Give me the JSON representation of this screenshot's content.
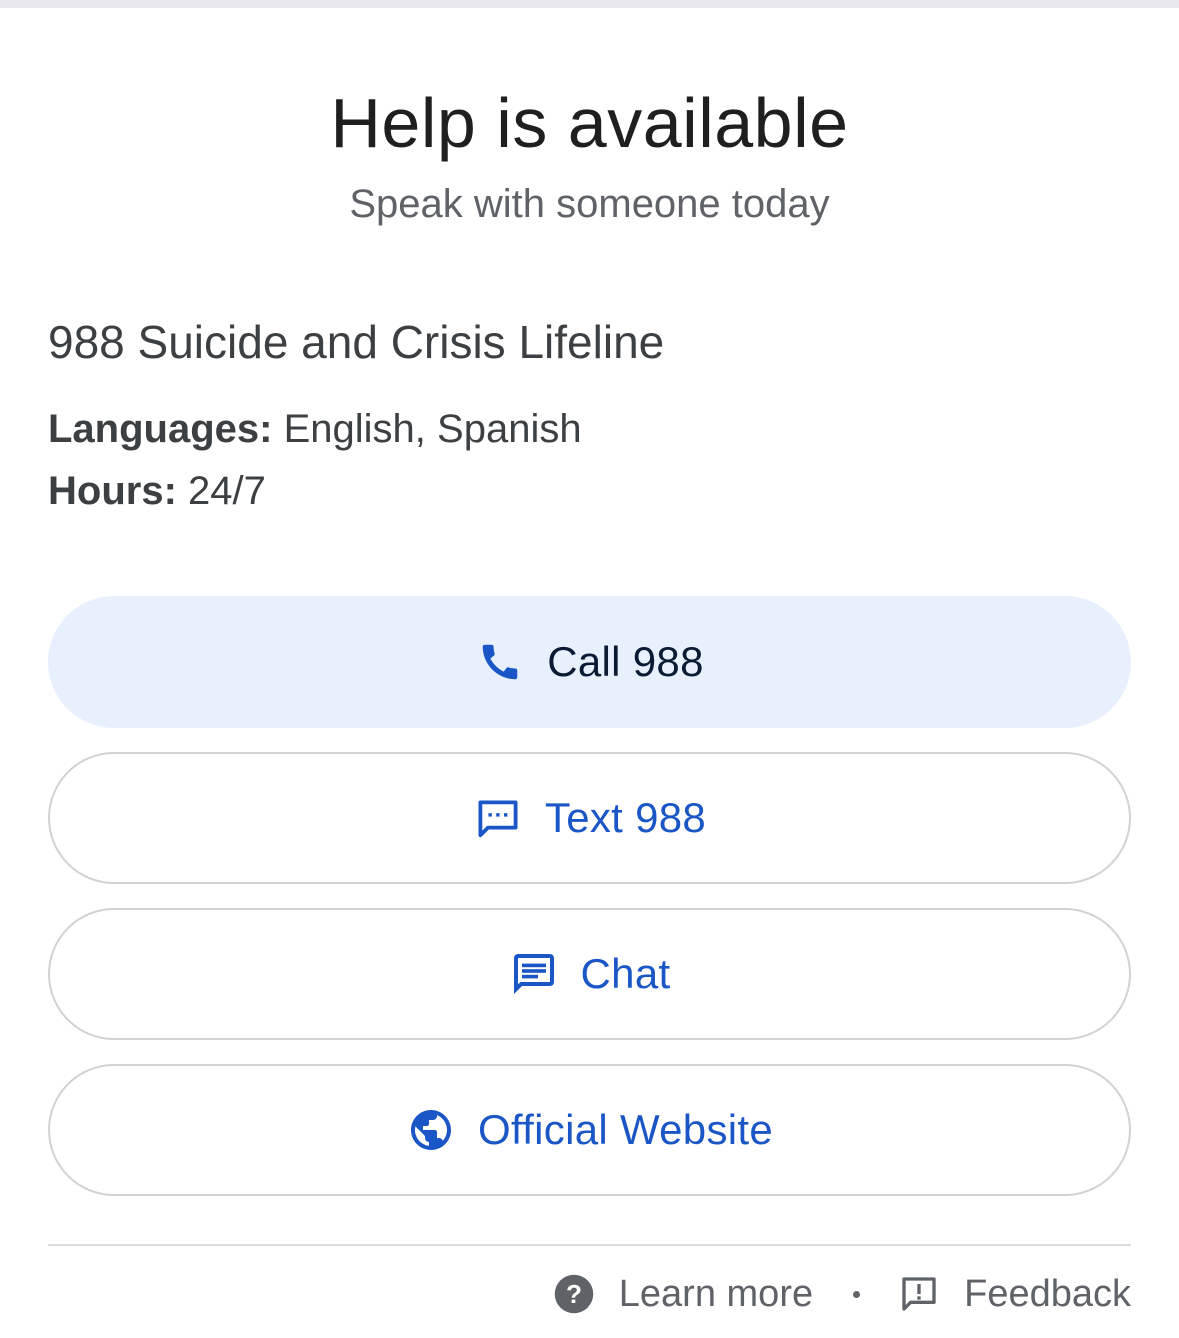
{
  "header": {
    "title": "Help is available",
    "subtitle": "Speak with someone today"
  },
  "organization": {
    "name": "988 Suicide and Crisis Lifeline",
    "languages_label": "Languages:",
    "languages_value": "English, Spanish",
    "hours_label": "Hours:",
    "hours_value": "24/7"
  },
  "actions": {
    "call": {
      "label": "Call 988",
      "icon": "phone-icon"
    },
    "text": {
      "label": "Text 988",
      "icon": "sms-icon"
    },
    "chat": {
      "label": "Chat",
      "icon": "chat-icon"
    },
    "website": {
      "label": "Official Website",
      "icon": "globe-icon"
    }
  },
  "footer": {
    "learn_more": "Learn more",
    "feedback": "Feedback"
  },
  "colors": {
    "accent": "#1a56c6",
    "primary_button_bg": "#e8f0fe",
    "text_primary": "#1f1f1f",
    "text_secondary": "#5f6368"
  }
}
